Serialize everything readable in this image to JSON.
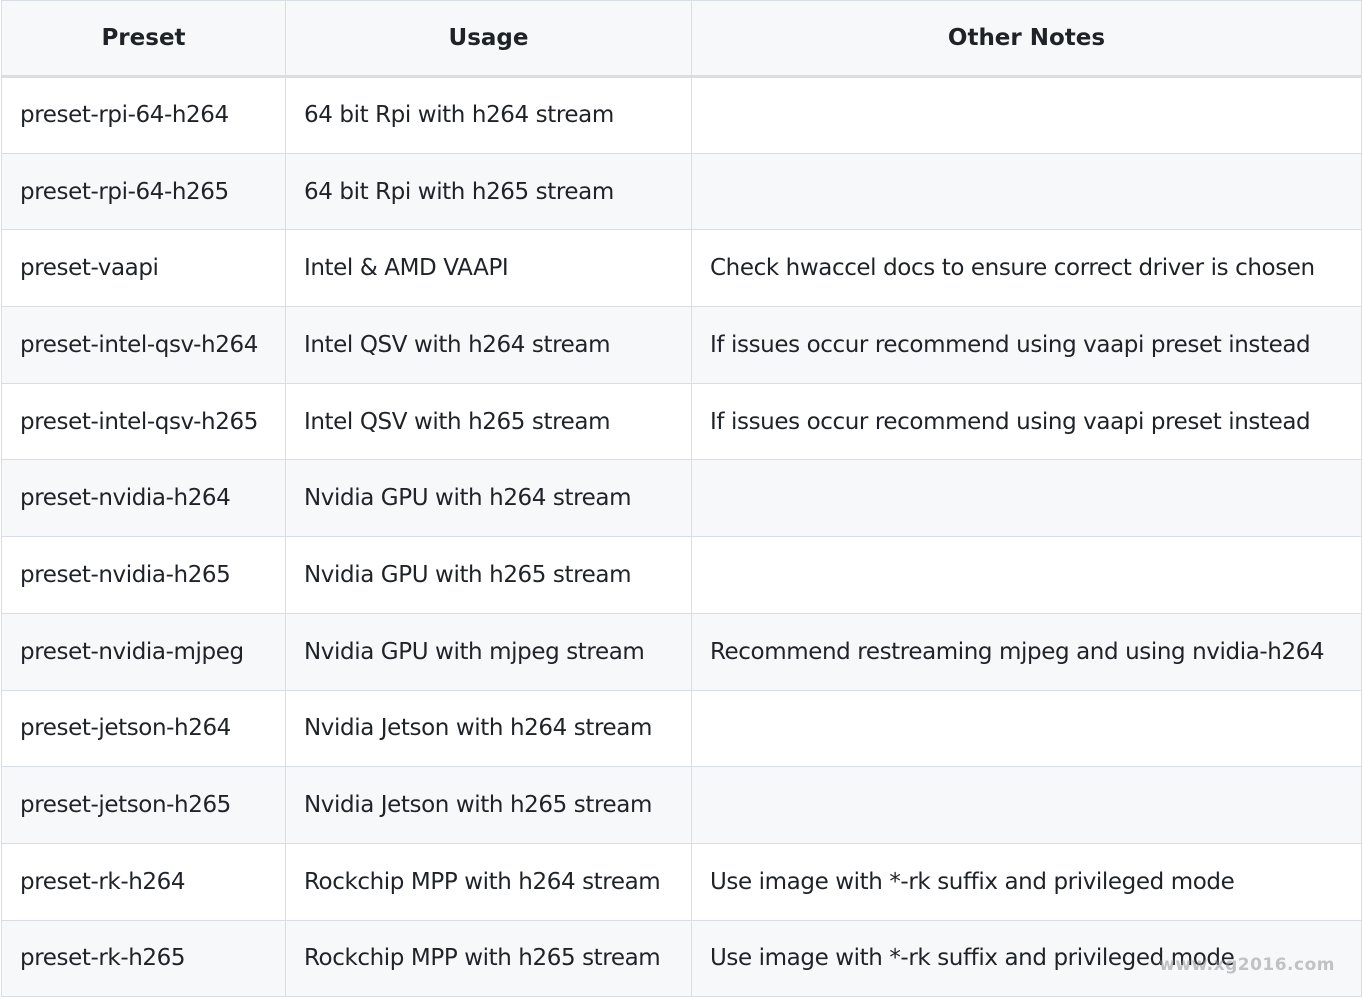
{
  "table": {
    "headers": [
      "Preset",
      "Usage",
      "Other Notes"
    ],
    "rows": [
      [
        "preset-rpi-64-h264",
        "64 bit Rpi with h264 stream",
        ""
      ],
      [
        "preset-rpi-64-h265",
        "64 bit Rpi with h265 stream",
        ""
      ],
      [
        "preset-vaapi",
        "Intel & AMD VAAPI",
        "Check hwaccel docs to ensure correct driver is chosen"
      ],
      [
        "preset-intel-qsv-h264",
        "Intel QSV with h264 stream",
        "If issues occur recommend using vaapi preset instead"
      ],
      [
        "preset-intel-qsv-h265",
        "Intel QSV with h265 stream",
        "If issues occur recommend using vaapi preset instead"
      ],
      [
        "preset-nvidia-h264",
        "Nvidia GPU with h264 stream",
        ""
      ],
      [
        "preset-nvidia-h265",
        "Nvidia GPU with h265 stream",
        ""
      ],
      [
        "preset-nvidia-mjpeg",
        "Nvidia GPU with mjpeg stream",
        "Recommend restreaming mjpeg and using nvidia-h264"
      ],
      [
        "preset-jetson-h264",
        "Nvidia Jetson with h264 stream",
        ""
      ],
      [
        "preset-jetson-h265",
        "Nvidia Jetson with h265 stream",
        ""
      ],
      [
        "preset-rk-h264",
        "Rockchip MPP with h264 stream",
        "Use image with *-rk suffix and privileged mode"
      ],
      [
        "preset-rk-h265",
        "Rockchip MPP with h265 stream",
        "Use image with *-rk suffix and privileged mode"
      ]
    ]
  },
  "watermark": "www.xg2016.com"
}
